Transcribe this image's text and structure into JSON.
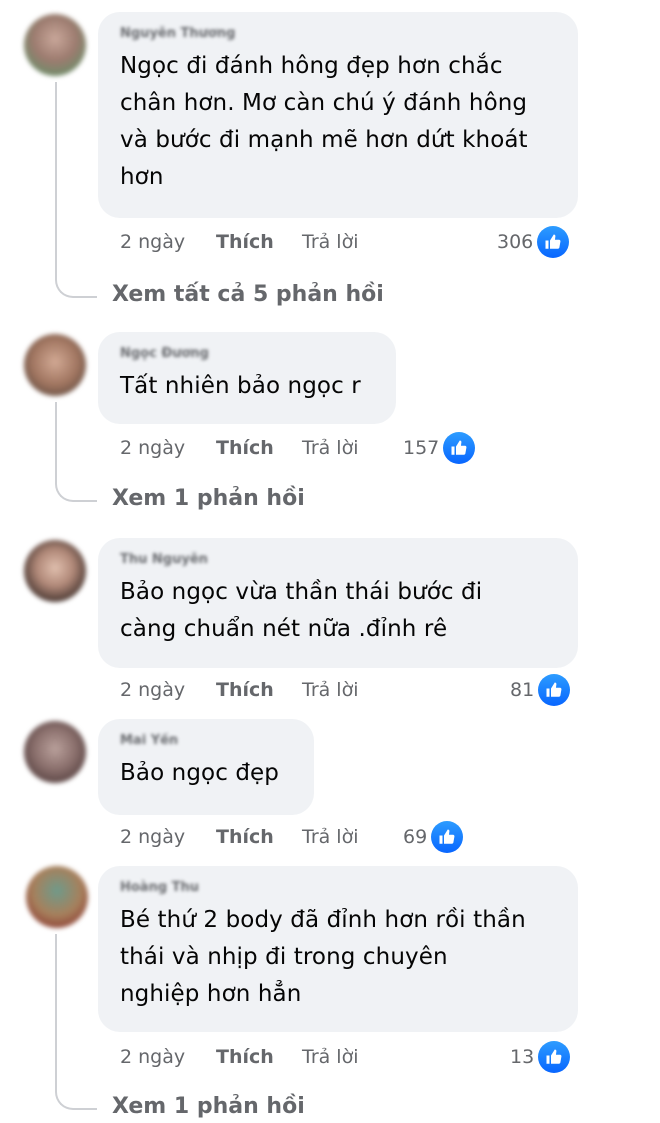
{
  "comments": [
    {
      "author": "Nguyễn Thương",
      "text": "Ngọc đi đánh hông đẹp hơn chắc\nchân hơn. Mơ càn chú ý đánh hông\nvà bước đi mạnh mẽ hơn dứt khoát\nhơn",
      "time": "2 ngày",
      "like": "Thích",
      "reply": "Trả lời",
      "reactions": "306",
      "view_replies": "Xem tất cả 5 phản hồi"
    },
    {
      "author": "Ngọc Đương",
      "text": "Tất nhiên bảo ngọc r",
      "time": "2 ngày",
      "like": "Thích",
      "reply": "Trả lời",
      "reactions": "157",
      "view_replies": "Xem 1 phản hồi"
    },
    {
      "author": "Thu Nguyễn",
      "text": "Bảo ngọc vừa thần thái bước đi\ncàng chuẩn nét nữa .đỉnh rê",
      "time": "2 ngày",
      "like": "Thích",
      "reply": "Trả lời",
      "reactions": "81"
    },
    {
      "author": "Mai Yến",
      "text": "Bảo ngọc đẹp",
      "time": "2 ngày",
      "like": "Thích",
      "reply": "Trả lời",
      "reactions": "69"
    },
    {
      "author": "Hoàng Thu",
      "text": "Bé thứ 2 body đã đỉnh hơn rồi thần\nthái và nhịp đi trong chuyên\nnghiệp hơn hẳn",
      "time": "2 ngày",
      "like": "Thích",
      "reply": "Trả lời",
      "reactions": "13",
      "view_replies": "Xem 1 phản hồi"
    }
  ],
  "colors": {
    "bubble": "#f0f2f5",
    "meta_text": "#65676b",
    "like_blue": "#0866ff",
    "thread_line": "#ced0d4"
  },
  "icons": [
    "avatar",
    "like-icon"
  ]
}
